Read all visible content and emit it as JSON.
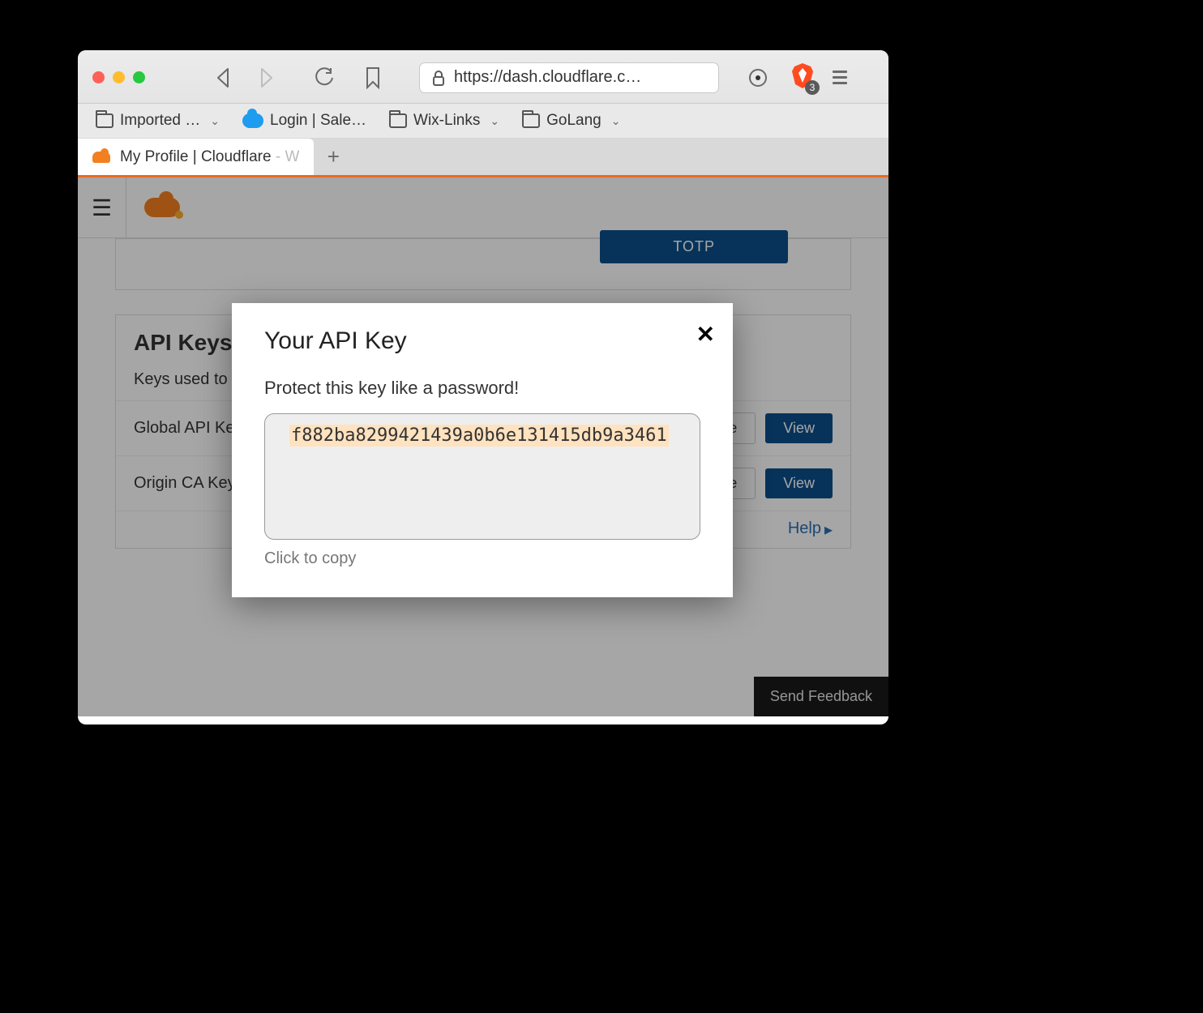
{
  "browser": {
    "url": "https://dash.cloudflare.c…",
    "brave_badge": "3",
    "bookmarks": [
      {
        "label": "Imported …",
        "type": "folder",
        "chevron": true
      },
      {
        "label": "Login | Sale…",
        "type": "cloud",
        "chevron": false
      },
      {
        "label": "Wix-Links",
        "type": "folder",
        "chevron": true
      },
      {
        "label": "GoLang",
        "type": "folder",
        "chevron": true
      }
    ],
    "tab_title_main": "My Profile | Cloudflare",
    "tab_title_trunc": " - W"
  },
  "page": {
    "totp_label": "TOTP",
    "section_title": "API Keys",
    "section_desc": "Keys used to",
    "rows": [
      {
        "label": "Global API Ke",
        "change": "e",
        "view": "View"
      },
      {
        "label": "Origin CA Key",
        "change": "e",
        "view": "View"
      }
    ],
    "help_label": "Help",
    "feedback_label": "Send Feedback"
  },
  "modal": {
    "title": "Your API Key",
    "subtitle": "Protect this key like a password!",
    "api_key": "f882ba8299421439a0b6e131415db9a3461",
    "copy_hint": "Click to copy"
  }
}
